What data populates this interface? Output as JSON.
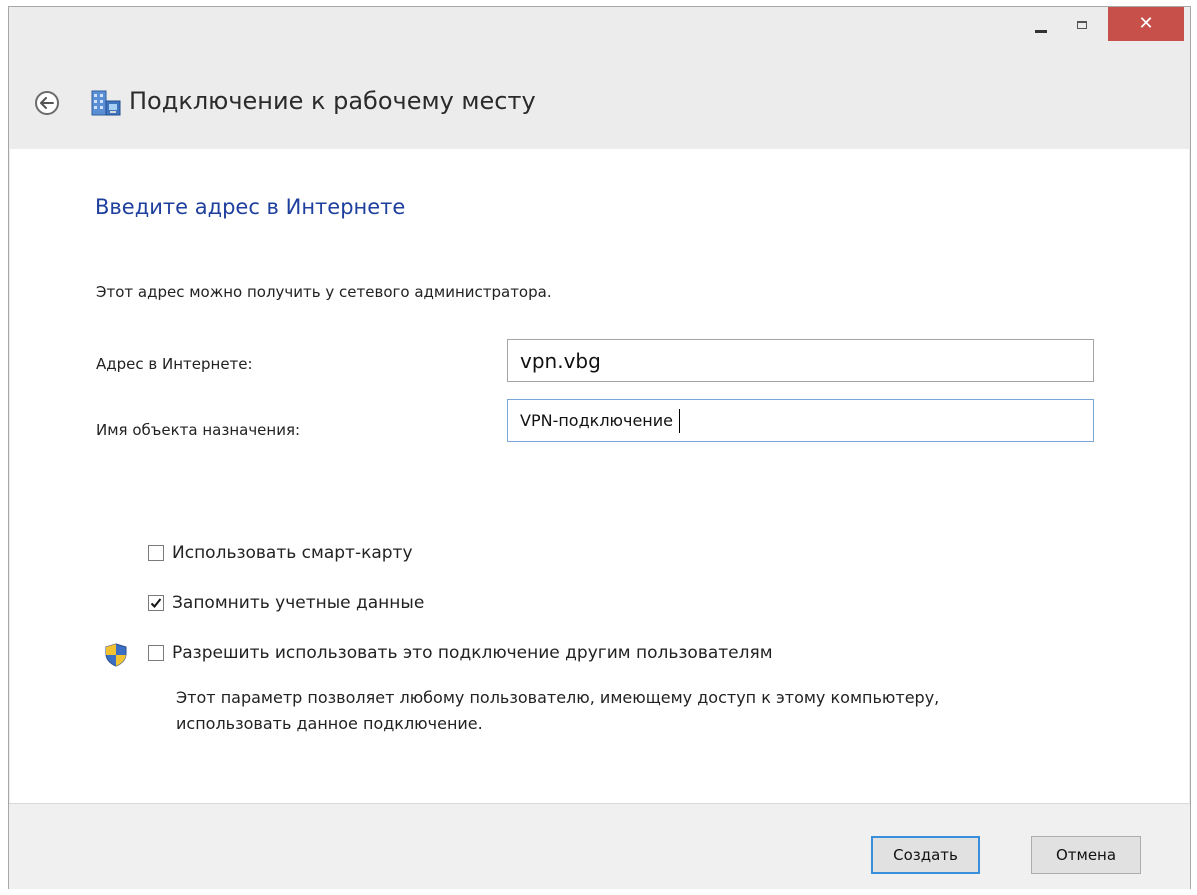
{
  "window": {
    "title": "Подключение к рабочему месту",
    "minimize_glyph": "▬",
    "close_glyph": "✕"
  },
  "page": {
    "heading": "Введите адрес в Интернете",
    "intro": "Этот адрес можно получить у сетевого администратора."
  },
  "fields": {
    "address_label": "Адрес в Интернете:",
    "address_value": "vpn.vbg",
    "destination_label": "Имя объекта назначения:",
    "destination_value": "VPN-подключение"
  },
  "options": {
    "smart_card": {
      "label": "Использовать смарт-карту",
      "checked": false
    },
    "remember": {
      "label": "Запомнить учетные данные",
      "checked": true
    },
    "allow_others": {
      "label": "Разрешить использовать это подключение другим пользователям",
      "checked": false
    },
    "description": "Этот параметр позволяет любому пользователю, имеющему доступ к этому компьютеру, использовать данное подключение."
  },
  "buttons": {
    "create": "Создать",
    "cancel": "Отмена"
  },
  "colors": {
    "heading": "#1e3f9e",
    "close": "#c7504b",
    "focus": "#3a8fdb"
  }
}
